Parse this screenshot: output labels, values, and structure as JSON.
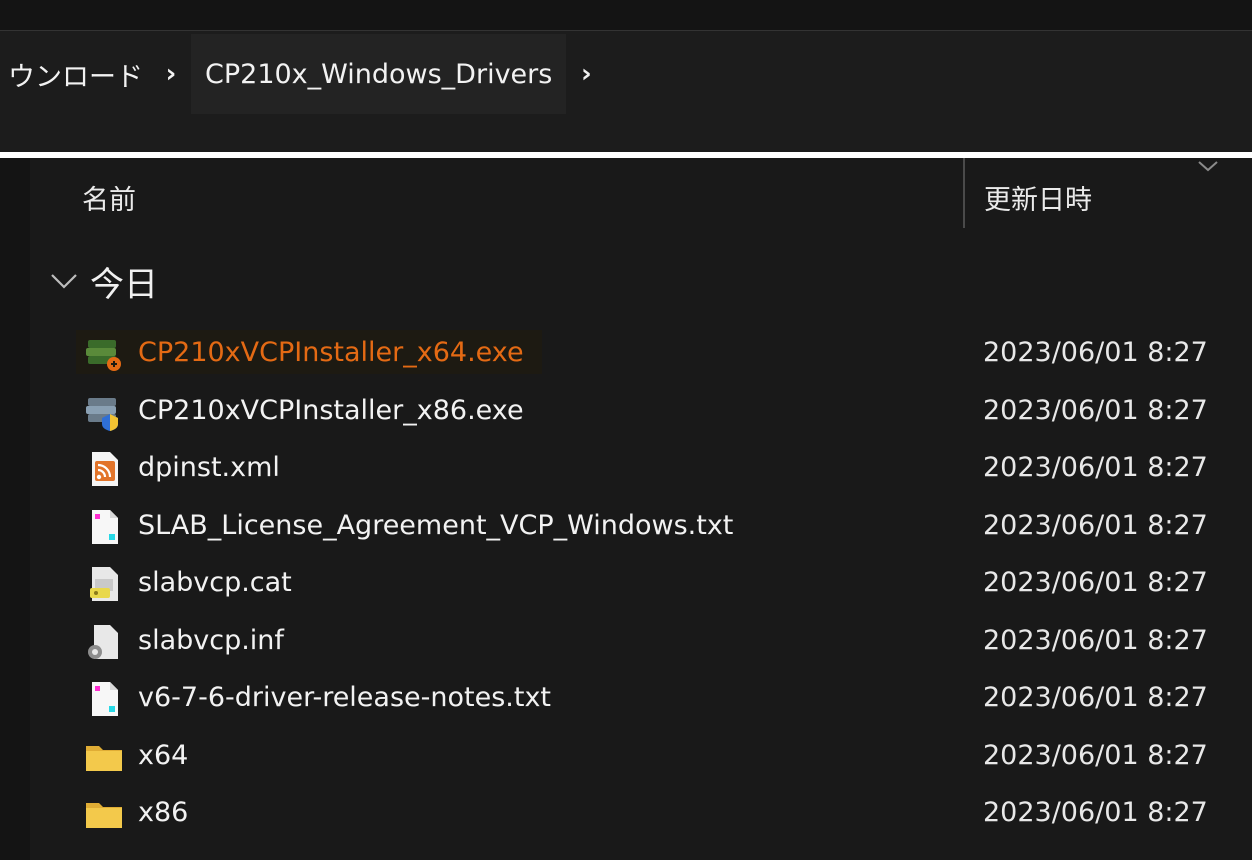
{
  "breadcrumb": {
    "parent": "ウンロード",
    "current": "CP210x_Windows_Drivers"
  },
  "columns": {
    "name": "名前",
    "date_modified": "更新日時"
  },
  "group": {
    "label": "今日"
  },
  "files": [
    {
      "name": "CP210xVCPInstaller_x64.exe",
      "date": "2023/06/01 8:27",
      "icon": "installer-exe-icon",
      "highlighted": true
    },
    {
      "name": "CP210xVCPInstaller_x86.exe",
      "date": "2023/06/01 8:27",
      "icon": "installer-exe-icon"
    },
    {
      "name": "dpinst.xml",
      "date": "2023/06/01 8:27",
      "icon": "xml-feed-icon"
    },
    {
      "name": "SLAB_License_Agreement_VCP_Windows.txt",
      "date": "2023/06/01 8:27",
      "icon": "text-file-icon"
    },
    {
      "name": "slabvcp.cat",
      "date": "2023/06/01 8:27",
      "icon": "security-catalog-icon"
    },
    {
      "name": "slabvcp.inf",
      "date": "2023/06/01 8:27",
      "icon": "setup-info-icon"
    },
    {
      "name": "v6-7-6-driver-release-notes.txt",
      "date": "2023/06/01 8:27",
      "icon": "text-file-icon"
    },
    {
      "name": "x64",
      "date": "2023/06/01 8:27",
      "icon": "folder-icon"
    },
    {
      "name": "x86",
      "date": "2023/06/01 8:27",
      "icon": "folder-icon"
    }
  ],
  "colors": {
    "background": "#191919",
    "highlight_text": "#e46a14",
    "folder": "#f3c94b"
  }
}
